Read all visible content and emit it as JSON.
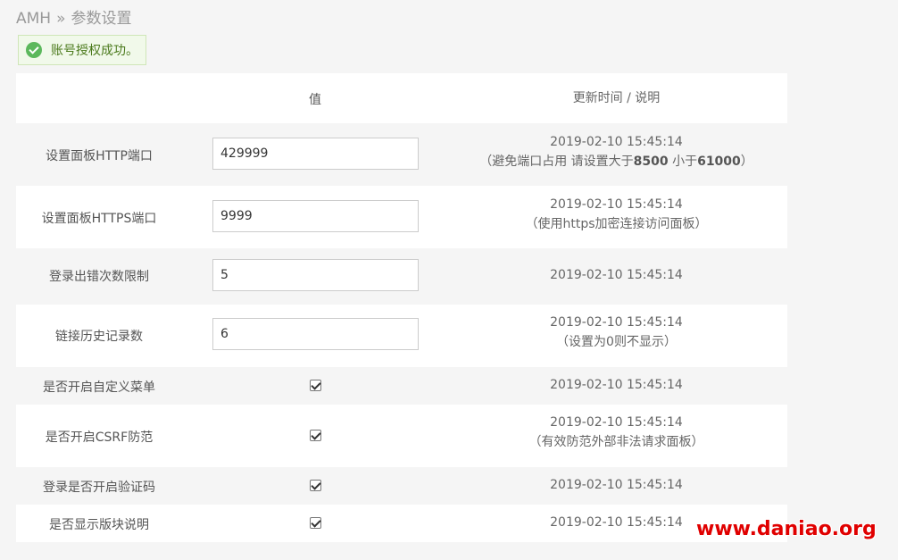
{
  "breadcrumb": {
    "root": "AMH",
    "separator": "»",
    "current": "参数设置"
  },
  "alert": {
    "message": "账号授权成功。",
    "icon": "check-circle-icon",
    "color": "#5cb85c"
  },
  "table": {
    "headers": {
      "value": "值",
      "update": "更新时间 / 说明"
    },
    "rows": [
      {
        "label": "设置面板HTTP端口",
        "type": "text",
        "value": "429999",
        "time": "2019-02-10 15:45:14",
        "note": "（避免端口占用 请设置大于8500 小于61000）"
      },
      {
        "label": "设置面板HTTPS端口",
        "type": "text",
        "value": "9999",
        "time": "2019-02-10 15:45:14",
        "note": "（使用https加密连接访问面板）"
      },
      {
        "label": "登录出错次数限制",
        "type": "text",
        "value": "5",
        "time": "2019-02-10 15:45:14",
        "note": ""
      },
      {
        "label": "链接历史记录数",
        "type": "text",
        "value": "6",
        "time": "2019-02-10 15:45:14",
        "note": "（设置为0则不显示）"
      },
      {
        "label": "是否开启自定义菜单",
        "type": "checkbox",
        "checked": true,
        "time": "2019-02-10 15:45:14",
        "note": ""
      },
      {
        "label": "是否开启CSRF防范",
        "type": "checkbox",
        "checked": true,
        "time": "2019-02-10 15:45:14",
        "note": "（有效防范外部非法请求面板）"
      },
      {
        "label": "登录是否开启验证码",
        "type": "checkbox",
        "checked": true,
        "time": "2019-02-10 15:45:14",
        "note": ""
      },
      {
        "label": "是否显示版块说明",
        "type": "checkbox",
        "checked": true,
        "time": "2019-02-10 15:45:14",
        "note": ""
      }
    ]
  },
  "watermark": "www.daniao.org"
}
